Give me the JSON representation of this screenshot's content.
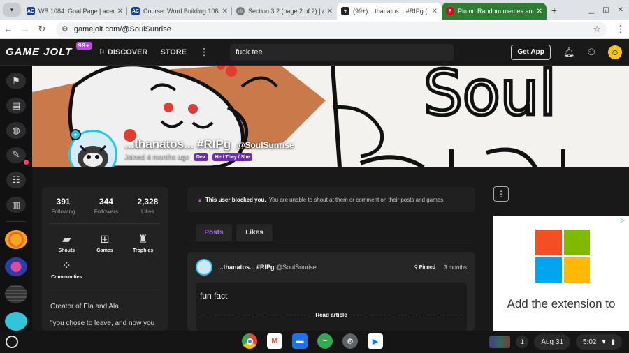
{
  "browser": {
    "tabs": [
      {
        "title": "WB 1084: Goal Page | acecor",
        "icon": "acecore-favicon-icon"
      },
      {
        "title": "Course: Word Building 1084",
        "icon": "acecore-favicon-icon"
      },
      {
        "title": "Section 3.2 (page 2 of 2) | ac",
        "icon": "globe-icon"
      },
      {
        "title": "(99+) ...thanatos... #RIPg (@S",
        "icon": "gamejolt-favicon-icon",
        "active": true
      },
      {
        "title": "Pin on Random memes and",
        "icon": "pinterest-favicon-icon"
      }
    ],
    "new_tab": "+",
    "address": "gamejolt.com/@SoulSunrise"
  },
  "site": {
    "logo": "GAME JOLT",
    "logo_badge": "99+",
    "discover": "DISCOVER",
    "store": "STORE",
    "search_value": "fuck tee",
    "get_app": "Get App"
  },
  "profile": {
    "name": "...thanatos... #RIPg",
    "handle": "@SoulSunrise",
    "joined": "Joined 4 months ago",
    "dev_badge": "Dev",
    "pronouns": "He / They / She",
    "stats": [
      {
        "value": "391",
        "label": "Following"
      },
      {
        "value": "344",
        "label": "Followers"
      },
      {
        "value": "2,328",
        "label": "Likes"
      }
    ],
    "links": [
      {
        "label": "Shouts",
        "icon": "shouts-icon"
      },
      {
        "label": "Games",
        "icon": "gamepad-icon"
      },
      {
        "label": "Trophies",
        "icon": "trophy-icon"
      },
      {
        "label": "Communities",
        "icon": "communities-icon"
      }
    ],
    "bio_lines": [
      "Creator of Ela and Ala",
      "\"you chose to leave, and now you"
    ]
  },
  "blocked": {
    "bold": "This user blocked you.",
    "text": "You are unable to shout at them or comment on their posts and games."
  },
  "feed_tabs": [
    "Posts",
    "Likes"
  ],
  "post": {
    "author": "...thanatos... #RIPg",
    "handle": "@SoulSunrise",
    "pinned": "Pinned",
    "age": "3 months",
    "title": "fun fact",
    "read_more": "Read article"
  },
  "ad": {
    "flag": "▷",
    "text": "Add the extension to"
  },
  "system": {
    "date": "Aug 31",
    "time": "5:02",
    "notification_count": "1"
  }
}
